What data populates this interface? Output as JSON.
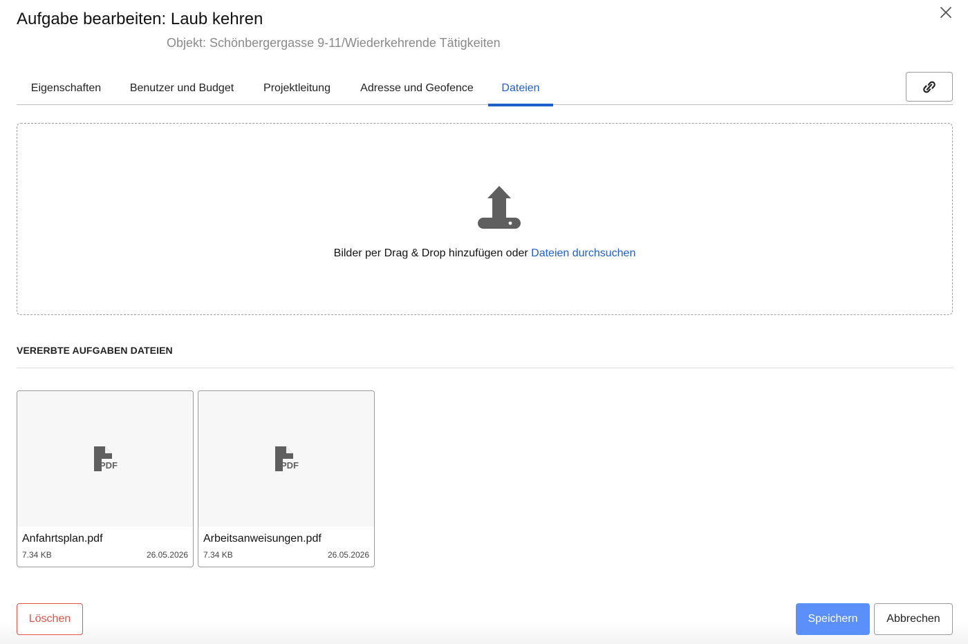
{
  "dialog": {
    "title": "Aufgabe bearbeiten: Laub kehren",
    "subtitle": "Objekt: Schönbergergasse 9-11/Wiederkehrende Tätigkeiten",
    "close_icon": "close-icon",
    "link_icon": "link-icon"
  },
  "tabs": [
    {
      "label": "Eigenschaften",
      "active": false
    },
    {
      "label": "Benutzer und Budget",
      "active": false
    },
    {
      "label": "Projektleitung",
      "active": false
    },
    {
      "label": "Adresse und Geofence",
      "active": false
    },
    {
      "label": "Dateien",
      "active": true
    }
  ],
  "dropzone": {
    "icon": "upload-icon",
    "text": "Bilder per Drag & Drop hinzufügen oder ",
    "link": "Dateien durchsuchen"
  },
  "inherited": {
    "title": "VERERBTE AUFGABEN DATEIEN",
    "files": [
      {
        "name": "Anfahrtsplan.pdf",
        "size": "7.34 KB",
        "date": "26.05.2026",
        "icon": "pdf-file-icon",
        "icon_label": "PDF"
      },
      {
        "name": "Arbeitsanweisungen.pdf",
        "size": "7.34 KB",
        "date": "26.05.2026",
        "icon": "pdf-file-icon",
        "icon_label": "PDF"
      }
    ]
  },
  "footer": {
    "delete_label": "Löschen",
    "save_label": "Speichern",
    "cancel_label": "Abbrechen"
  },
  "colors": {
    "accent": "#1f5fcc",
    "save_button": "#5b8ff9",
    "delete": "#e5534b",
    "icon_gray": "#5f5f5f"
  }
}
